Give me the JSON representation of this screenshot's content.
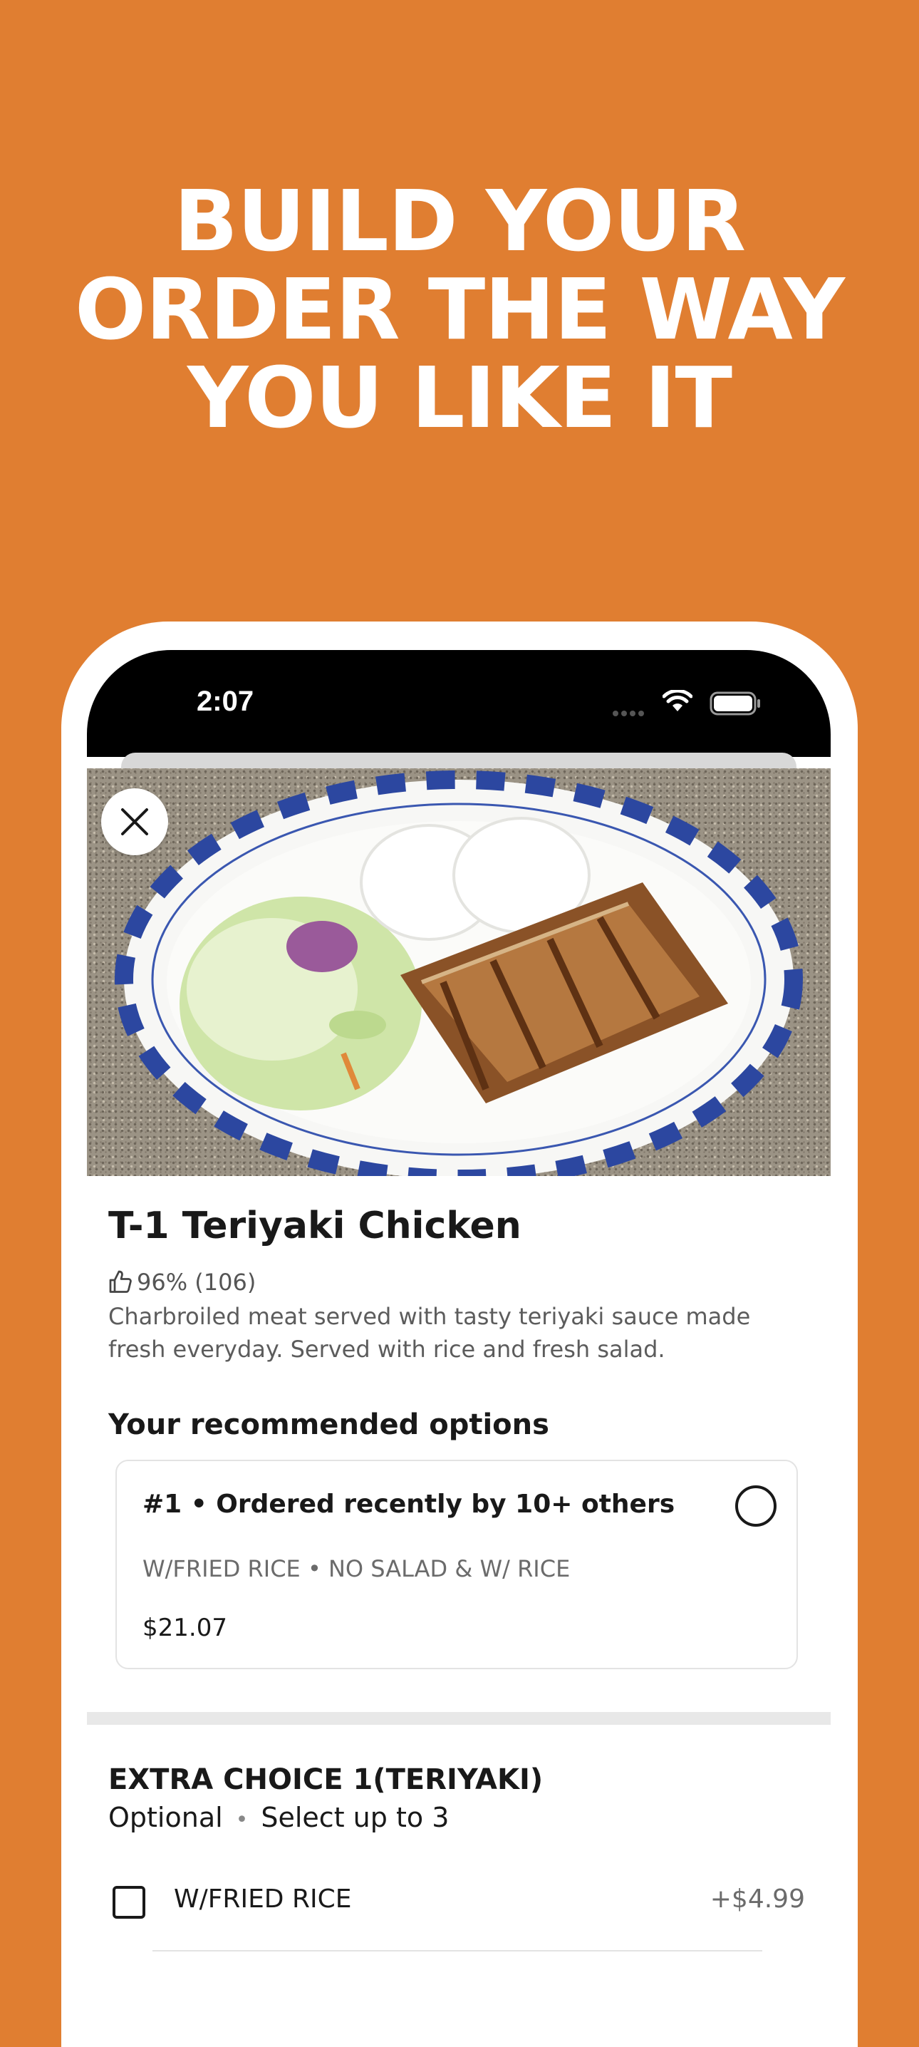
{
  "promo": {
    "headline_lines": [
      "BUILD YOUR",
      "ORDER THE WAY",
      "YOU LIKE IT"
    ]
  },
  "status_bar": {
    "time": "2:07",
    "icons": [
      "cellular-signal-icon",
      "wifi-icon",
      "battery-icon"
    ]
  },
  "item": {
    "photo": "teriyaki-chicken-plate-photo",
    "close_icon": "close-icon",
    "title": "T-1 Teriyaki Chicken",
    "rating": "96% (106)",
    "rating_icon": "thumbs-up-icon",
    "description": "Charbroiled meat served with tasty teriyaki sauce made fresh everyday. Served with rice and fresh salad."
  },
  "recommended": {
    "heading": "Your recommended options",
    "options": [
      {
        "title": "#1 • Ordered recently by 10+ others",
        "choices": "W/FRIED RICE • NO SALAD & W/ RICE",
        "price": "$21.07",
        "selected": false
      }
    ]
  },
  "extra_choice": {
    "title": "EXTRA CHOICE 1(TERIYAKI)",
    "requirement": "Optional",
    "limit": "Select up to 3",
    "items": [
      {
        "label": "W/FRIED RICE",
        "price": "+$4.99",
        "checked": false
      }
    ]
  },
  "colors": {
    "background": "#E07E31",
    "text_primary": "#191919",
    "text_secondary": "#6b6b6b"
  }
}
